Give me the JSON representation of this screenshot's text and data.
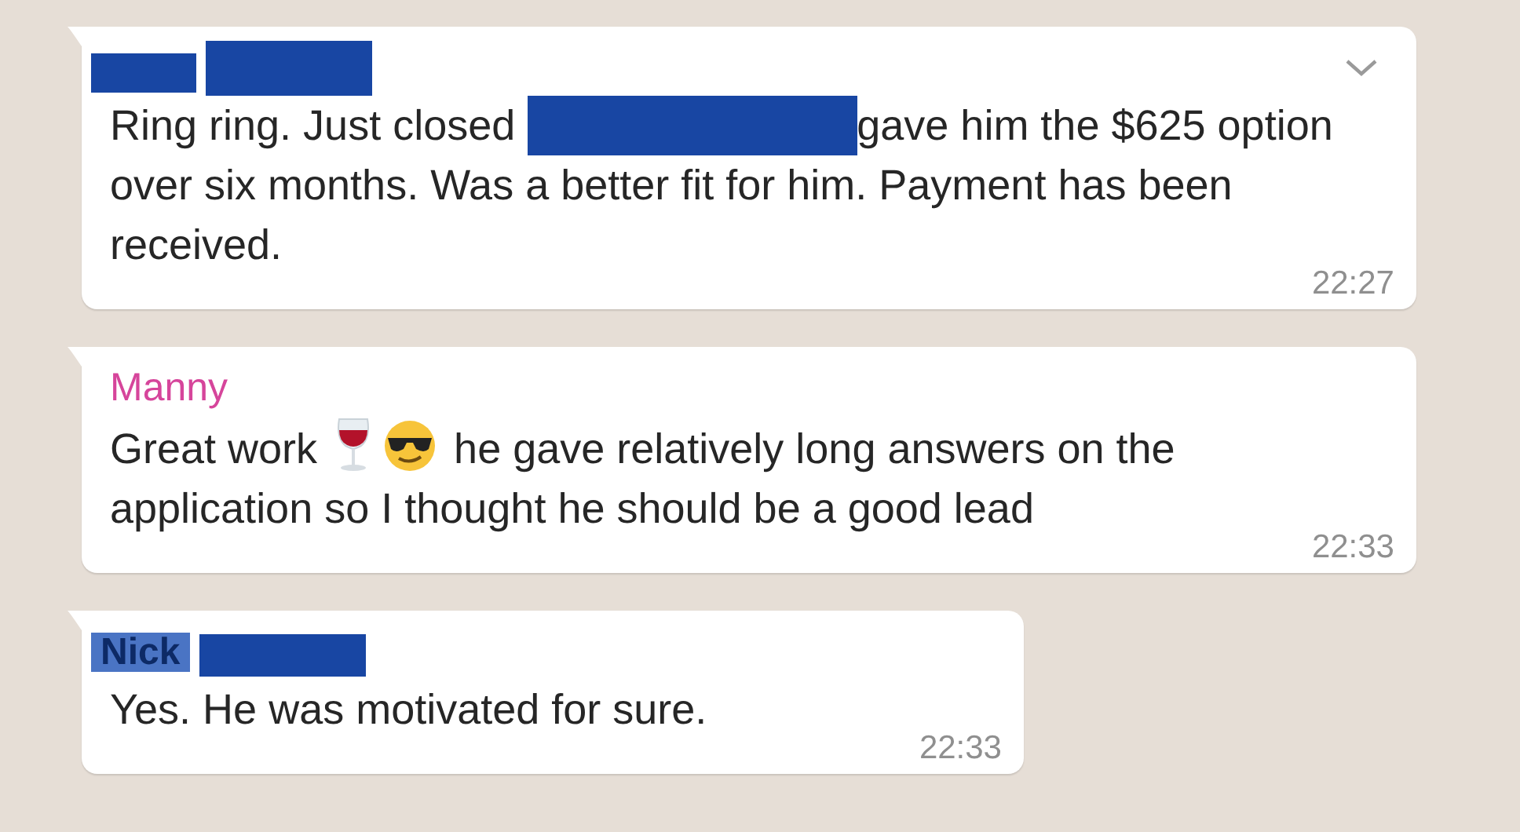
{
  "messages": [
    {
      "sender": {
        "kind": "hidden"
      },
      "has_menu": true,
      "parts": [
        {
          "kind": "text",
          "text": "Ring ring. Just closed "
        },
        {
          "kind": "redaction"
        },
        {
          "kind": "text",
          "text": "gave him the $625 option over six months. Was a better fit for him. Payment has been received."
        }
      ],
      "time": "22:27"
    },
    {
      "sender": {
        "kind": "name",
        "name": "Manny",
        "color": "#d6459b"
      },
      "has_menu": false,
      "parts": [
        {
          "kind": "text",
          "text": "Great work "
        },
        {
          "kind": "wine"
        },
        {
          "kind": "sunglasses"
        },
        {
          "kind": "text",
          "text": " he gave relatively long answers on the application so I thought he should be a good lead"
        }
      ],
      "time": "22:33"
    },
    {
      "sender": {
        "kind": "covered",
        "name": "Nick"
      },
      "has_menu": false,
      "parts": [
        {
          "kind": "text",
          "text": "Yes. He was motivated for sure."
        }
      ],
      "time": "22:33"
    }
  ]
}
